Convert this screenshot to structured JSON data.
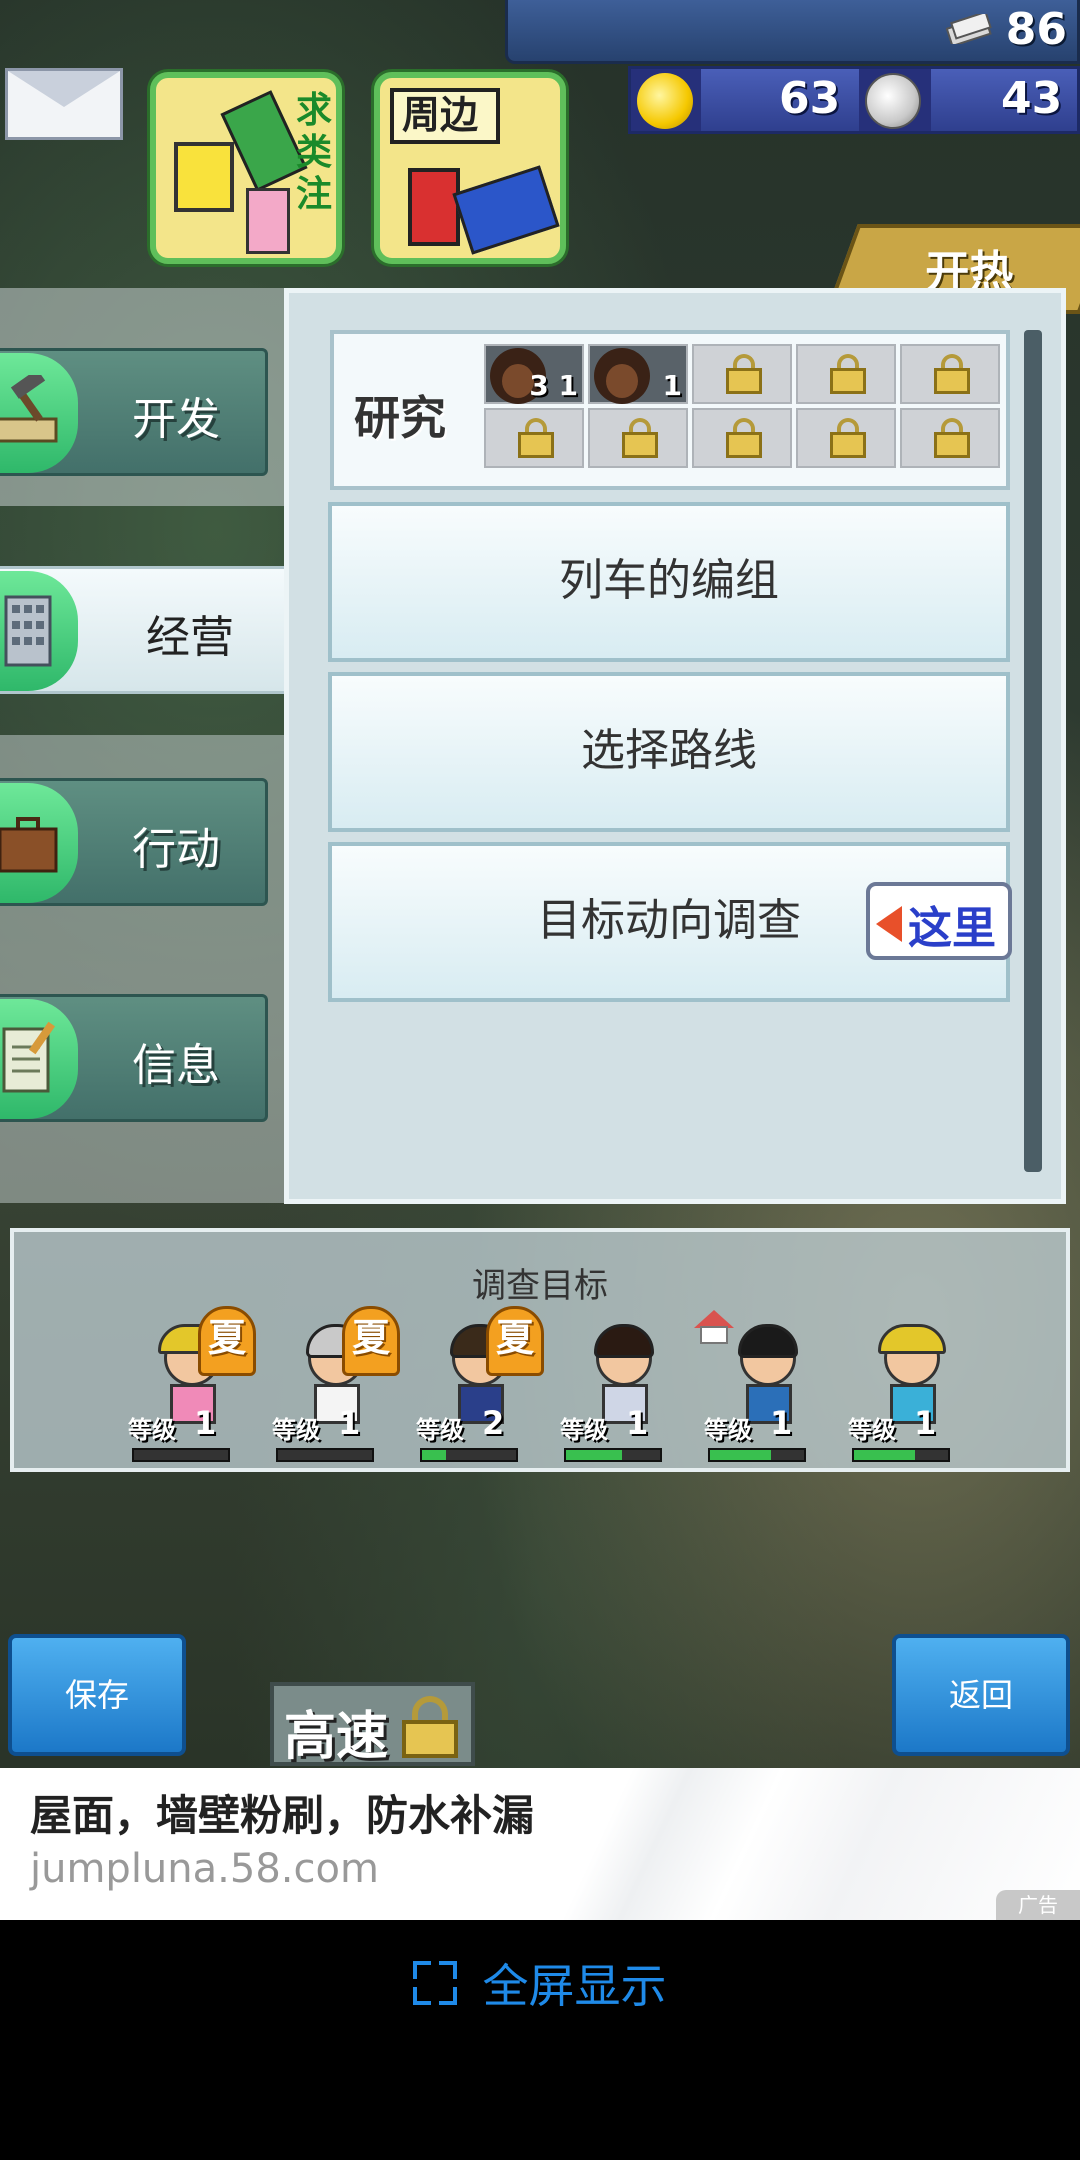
{
  "resources": {
    "money": "86",
    "ideas": "63",
    "coins": "43"
  },
  "shop_buttons": [
    {
      "label": "求类注"
    },
    {
      "label": "周边"
    }
  ],
  "hot_tag": "开热",
  "menu": [
    {
      "label": "开发",
      "icon": "hammer-icon",
      "active": false
    },
    {
      "label": "经营",
      "icon": "building-icon",
      "active": true
    },
    {
      "label": "行动",
      "icon": "briefcase-icon",
      "active": false
    },
    {
      "label": "信息",
      "icon": "clipboard-icon",
      "active": false
    }
  ],
  "research": {
    "label": "研究",
    "slots": [
      {
        "state": "staff",
        "count": "3 1"
      },
      {
        "state": "staff",
        "count": "1"
      },
      {
        "state": "locked"
      },
      {
        "state": "locked"
      },
      {
        "state": "locked"
      },
      {
        "state": "locked"
      },
      {
        "state": "locked"
      },
      {
        "state": "locked"
      },
      {
        "state": "locked"
      },
      {
        "state": "locked"
      }
    ]
  },
  "actions": [
    {
      "label": "列车的编组"
    },
    {
      "label": "选择路线"
    },
    {
      "label": "目标动向调查"
    }
  ],
  "here_badge": "这里",
  "survey": {
    "title": "调查目标",
    "level_label": "等级",
    "summer_label": "夏",
    "targets": [
      {
        "level": "1",
        "progress": 0,
        "summer": true
      },
      {
        "level": "1",
        "progress": 0,
        "summer": true
      },
      {
        "level": "2",
        "progress": 0.25,
        "summer": true
      },
      {
        "level": "1",
        "progress": 0.6,
        "summer": false
      },
      {
        "level": "1",
        "progress": 0.65,
        "summer": false,
        "house": true
      },
      {
        "level": "1",
        "progress": 0.65,
        "summer": false
      }
    ]
  },
  "buttons": {
    "save": "保存",
    "speed": "高速",
    "back": "返回"
  },
  "ad": {
    "title": "屋面，墙壁粉刷，防水补漏",
    "url": "jumpluna.58.com",
    "tag": "广告"
  },
  "fullscreen_label": "全屏显示",
  "colors": {
    "accent_blue": "#1f8ae8",
    "menu_green": "#43706a",
    "panel_bg": "#d2e0e4"
  }
}
